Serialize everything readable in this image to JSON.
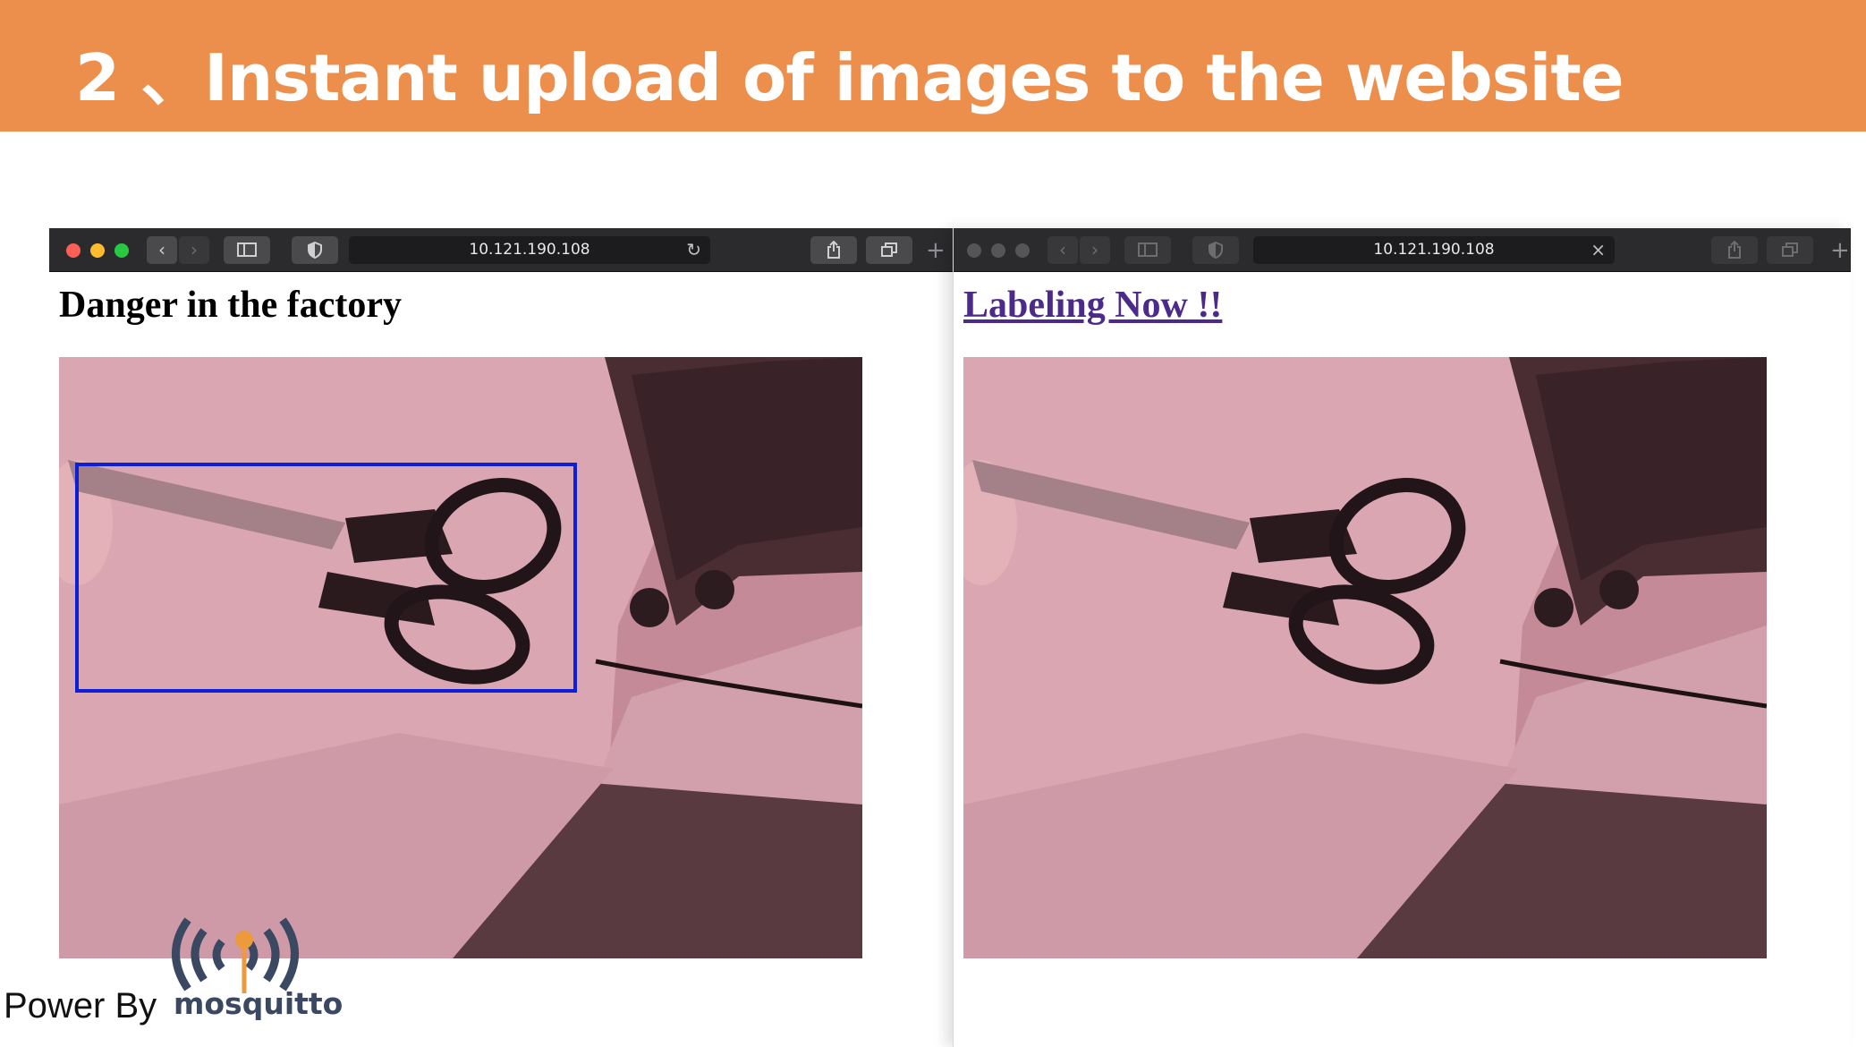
{
  "slide": {
    "title": "2 、Instant upload of images to the website",
    "banner_color": "#ec8f4d"
  },
  "browser_left": {
    "address": "10.121.190.108",
    "address_icon": "reload-icon",
    "heading": "Danger in the factory",
    "detection_box_color": "#0a1fd6"
  },
  "browser_right": {
    "address": "10.121.190.108",
    "address_icon": "close-icon",
    "link_text": "Labeling Now !!",
    "link_color": "#4c2a8a"
  },
  "footer": {
    "power_label": "Power By",
    "logo_text": "mosquitto",
    "logo_color": "#3a4862",
    "logo_accent": "#ec9a3c"
  }
}
